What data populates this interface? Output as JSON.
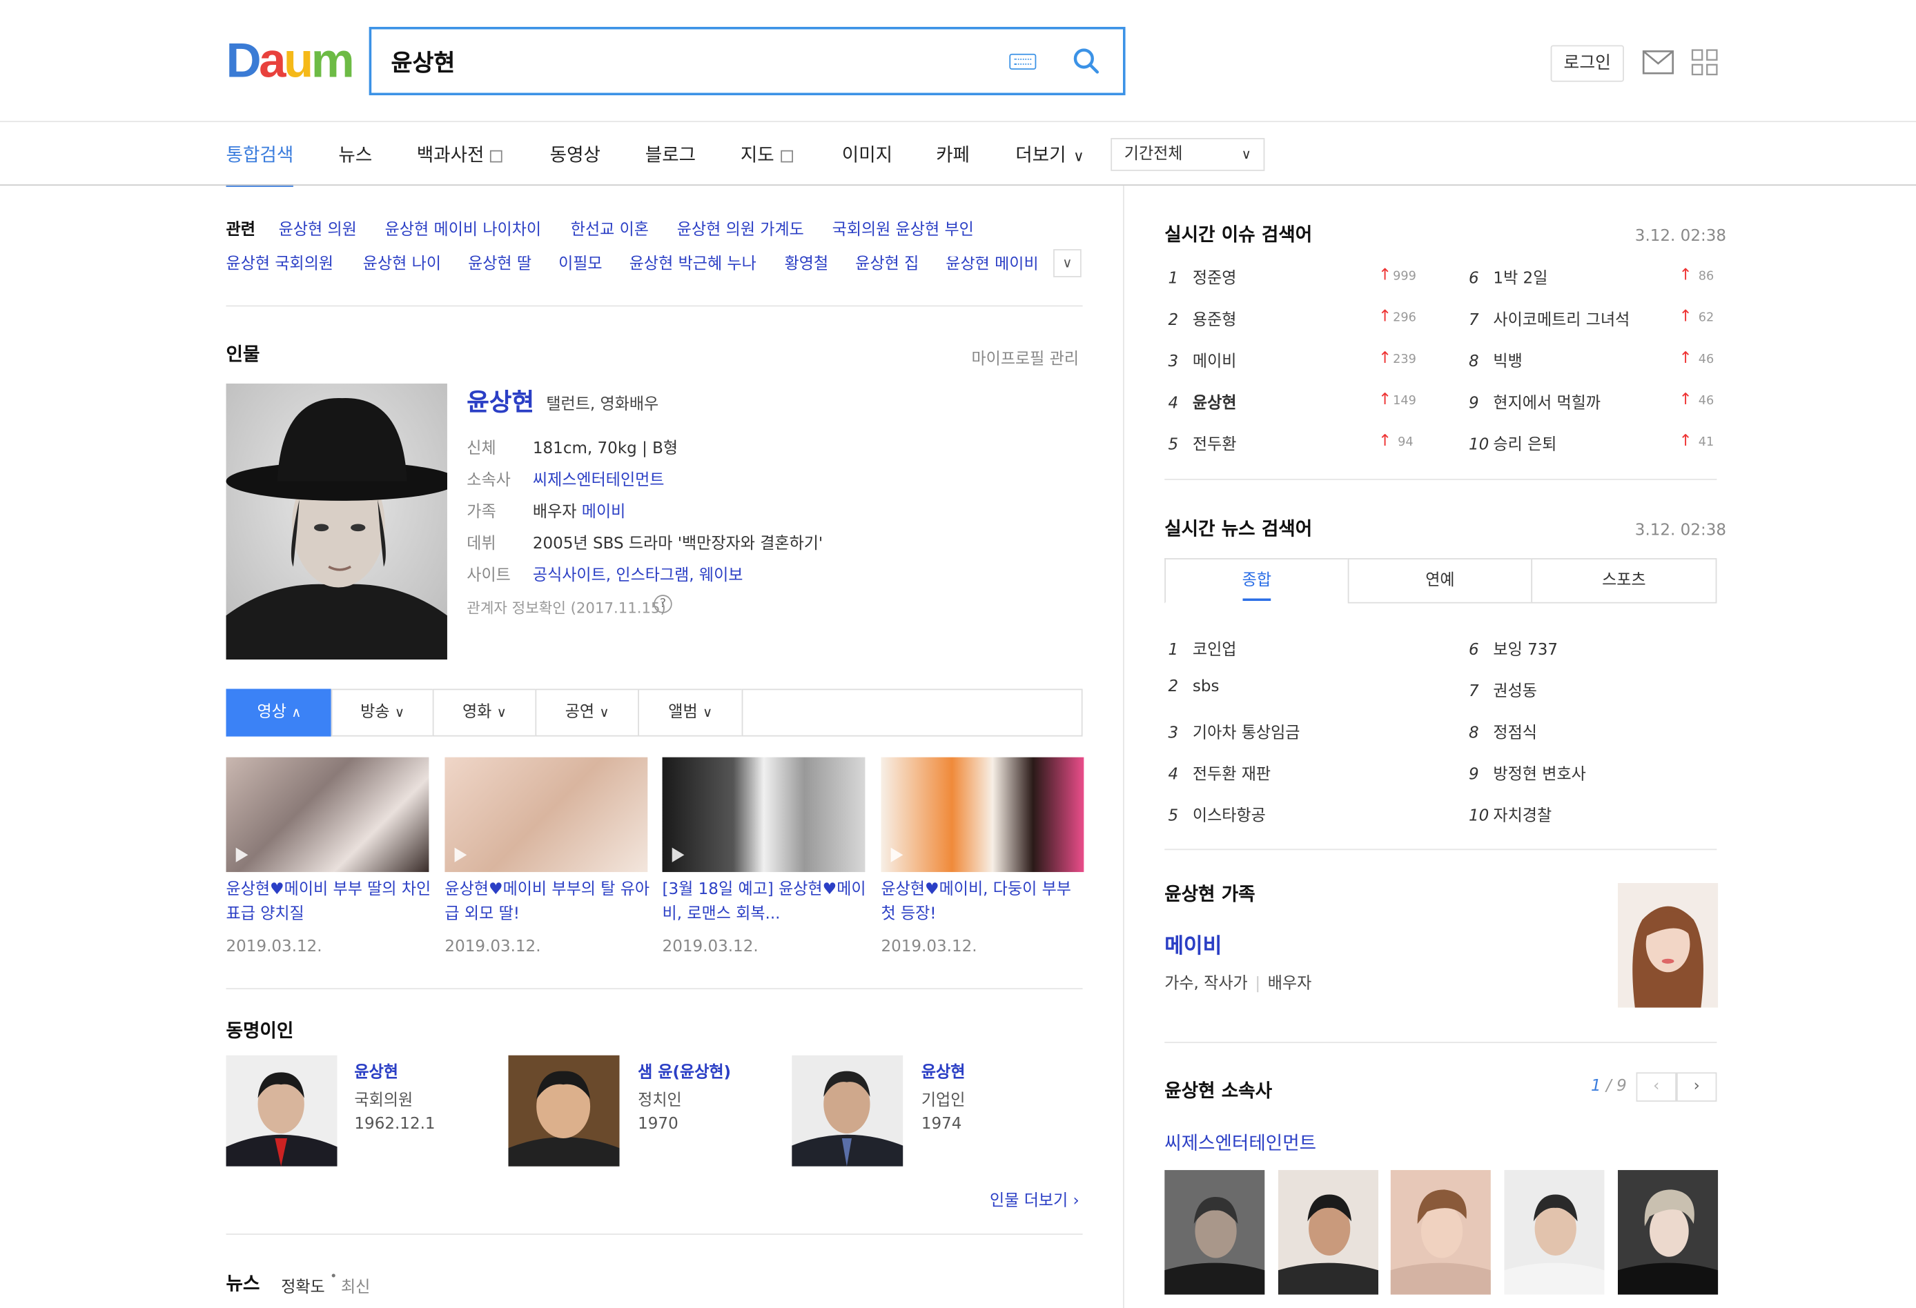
{
  "header": {
    "logo_letters": [
      "D",
      "a",
      "u",
      "m"
    ],
    "search_value": "윤상현",
    "login_label": "로그인"
  },
  "nav": {
    "tabs": [
      "통합검색",
      "뉴스",
      "백과사전",
      "동영상",
      "블로그",
      "지도",
      "이미지",
      "카페",
      "더보기"
    ],
    "period": "기간전체"
  },
  "related": {
    "label": "관련",
    "row1": [
      "윤상현 의원",
      "윤상현 메이비 나이차이",
      "한선교 이혼",
      "윤상현 의원 가계도",
      "국회의원 윤상현 부인"
    ],
    "row2": [
      "윤상현 국회의원",
      "윤상현 나이",
      "윤상현 딸",
      "이필모",
      "윤상현 박근혜 누나",
      "황영철",
      "윤상현 집",
      "윤상현 메이비"
    ]
  },
  "person": {
    "section_title": "인물",
    "manage_link": "마이프로필 관리",
    "name": "윤상현",
    "role": "탤런트, 영화배우",
    "rows": [
      {
        "label": "신체",
        "value": "181cm, 70kg  |  B형"
      },
      {
        "label": "소속사",
        "value": "씨제스엔터테인먼트"
      },
      {
        "label": "가족",
        "prefix": "배우자",
        "value": "메이비"
      },
      {
        "label": "데뷔",
        "value": "2005년 SBS 드라마 '백만장자와 결혼하기'"
      },
      {
        "label": "사이트",
        "value": "공식사이트, 인스타그램, 웨이보"
      }
    ],
    "confirm": "관계자 정보확인 (2017.11.15)"
  },
  "media_tabs": [
    "영상",
    "방송",
    "영화",
    "공연",
    "앨범"
  ],
  "videos": [
    {
      "title": "윤상현♥메이비 부부 딸의 차인표급 양치질",
      "date": "2019.03.12."
    },
    {
      "title": "윤상현♥메이비 부부의 탈 유아급 외모 딸!",
      "date": "2019.03.12."
    },
    {
      "title": "[3월 18일 예고] 윤상현♥메이비, 로맨스 회복...",
      "date": "2019.03.12."
    },
    {
      "title": "윤상현♥메이비, 다둥이 부부 첫 등장!",
      "date": "2019.03.12."
    }
  ],
  "samename": {
    "title": "동명이인",
    "people": [
      {
        "name": "윤상현",
        "job": "국회의원",
        "year": "1962.12.1"
      },
      {
        "name": "샘 윤(윤상현)",
        "job": "정치인",
        "year": "1970"
      },
      {
        "name": "윤상현",
        "job": "기업인",
        "year": "1974"
      }
    ],
    "more": "인물 더보기"
  },
  "news": {
    "title": "뉴스",
    "sort1": "정확도",
    "sort2": "최신"
  },
  "realtime_issue": {
    "title": "실시간 이슈 검색어",
    "time": "3.12. 02:38",
    "items": [
      {
        "rank": "1",
        "word": "정준영",
        "delta": "999"
      },
      {
        "rank": "2",
        "word": "용준형",
        "delta": "296"
      },
      {
        "rank": "3",
        "word": "메이비",
        "delta": "239"
      },
      {
        "rank": "4",
        "word": "윤상현",
        "delta": "149"
      },
      {
        "rank": "5",
        "word": "전두환",
        "delta": "94"
      },
      {
        "rank": "6",
        "word": "1박 2일",
        "delta": "86"
      },
      {
        "rank": "7",
        "word": "사이코메트리 그녀석",
        "delta": "62"
      },
      {
        "rank": "8",
        "word": "빅뱅",
        "delta": "46"
      },
      {
        "rank": "9",
        "word": "현지에서 먹힐까",
        "delta": "46"
      },
      {
        "rank": "10",
        "word": "승리 은퇴",
        "delta": "41"
      }
    ]
  },
  "realtime_news": {
    "title": "실시간 뉴스 검색어",
    "time": "3.12. 02:38",
    "tabs": [
      "종합",
      "연예",
      "스포츠"
    ],
    "items": [
      {
        "rank": "1",
        "word": "코인업"
      },
      {
        "rank": "2",
        "word": "sbs"
      },
      {
        "rank": "3",
        "word": "기아차 통상임금"
      },
      {
        "rank": "4",
        "word": "전두환 재판"
      },
      {
        "rank": "5",
        "word": "이스타항공"
      },
      {
        "rank": "6",
        "word": "보잉 737"
      },
      {
        "rank": "7",
        "word": "권성동"
      },
      {
        "rank": "8",
        "word": "정점식"
      },
      {
        "rank": "9",
        "word": "방정현 변호사"
      },
      {
        "rank": "10",
        "word": "자치경찰"
      }
    ]
  },
  "family": {
    "title": "윤상현 가족",
    "name": "메이비",
    "job": "가수, 작사가",
    "relation": "배우자"
  },
  "agency": {
    "title": "윤상현 소속사",
    "page": "1",
    "total": "/ 9",
    "name": "씨제스엔터테인먼트"
  }
}
